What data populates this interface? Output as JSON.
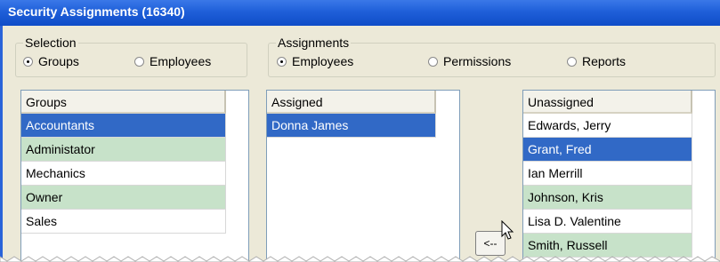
{
  "window": {
    "title": "Security Assignments (16340)"
  },
  "selection": {
    "legend": "Selection",
    "options": [
      {
        "label": "Groups",
        "selected": true
      },
      {
        "label": "Employees",
        "selected": false
      }
    ]
  },
  "assignments": {
    "legend": "Assignments",
    "options": [
      {
        "label": "Employees",
        "selected": true
      },
      {
        "label": "Permissions",
        "selected": false
      },
      {
        "label": "Reports",
        "selected": false
      }
    ]
  },
  "groups_list": {
    "header": "Groups",
    "rows": [
      {
        "label": "Accountants",
        "state": "selected"
      },
      {
        "label": "Administator",
        "state": "green"
      },
      {
        "label": "Mechanics",
        "state": "normal"
      },
      {
        "label": "Owner",
        "state": "green"
      },
      {
        "label": "Sales",
        "state": "normal"
      }
    ]
  },
  "assigned_list": {
    "header": "Assigned",
    "rows": [
      {
        "label": "Donna James",
        "state": "selected"
      }
    ]
  },
  "unassigned_list": {
    "header": "Unassigned",
    "rows": [
      {
        "label": "Edwards, Jerry",
        "state": "normal"
      },
      {
        "label": "Grant, Fred",
        "state": "selected"
      },
      {
        "label": "Ian Merrill",
        "state": "normal"
      },
      {
        "label": "Johnson, Kris",
        "state": "green"
      },
      {
        "label": "Lisa D. Valentine",
        "state": "normal"
      },
      {
        "label": "Smith, Russell",
        "state": "green"
      }
    ]
  },
  "move_left_button": {
    "label": "<--"
  },
  "colors": {
    "title_bar": "#1f5fd9",
    "selected_row": "#3169c6",
    "alt_row": "#c7e2c9",
    "window_bg": "#ece9d8"
  }
}
